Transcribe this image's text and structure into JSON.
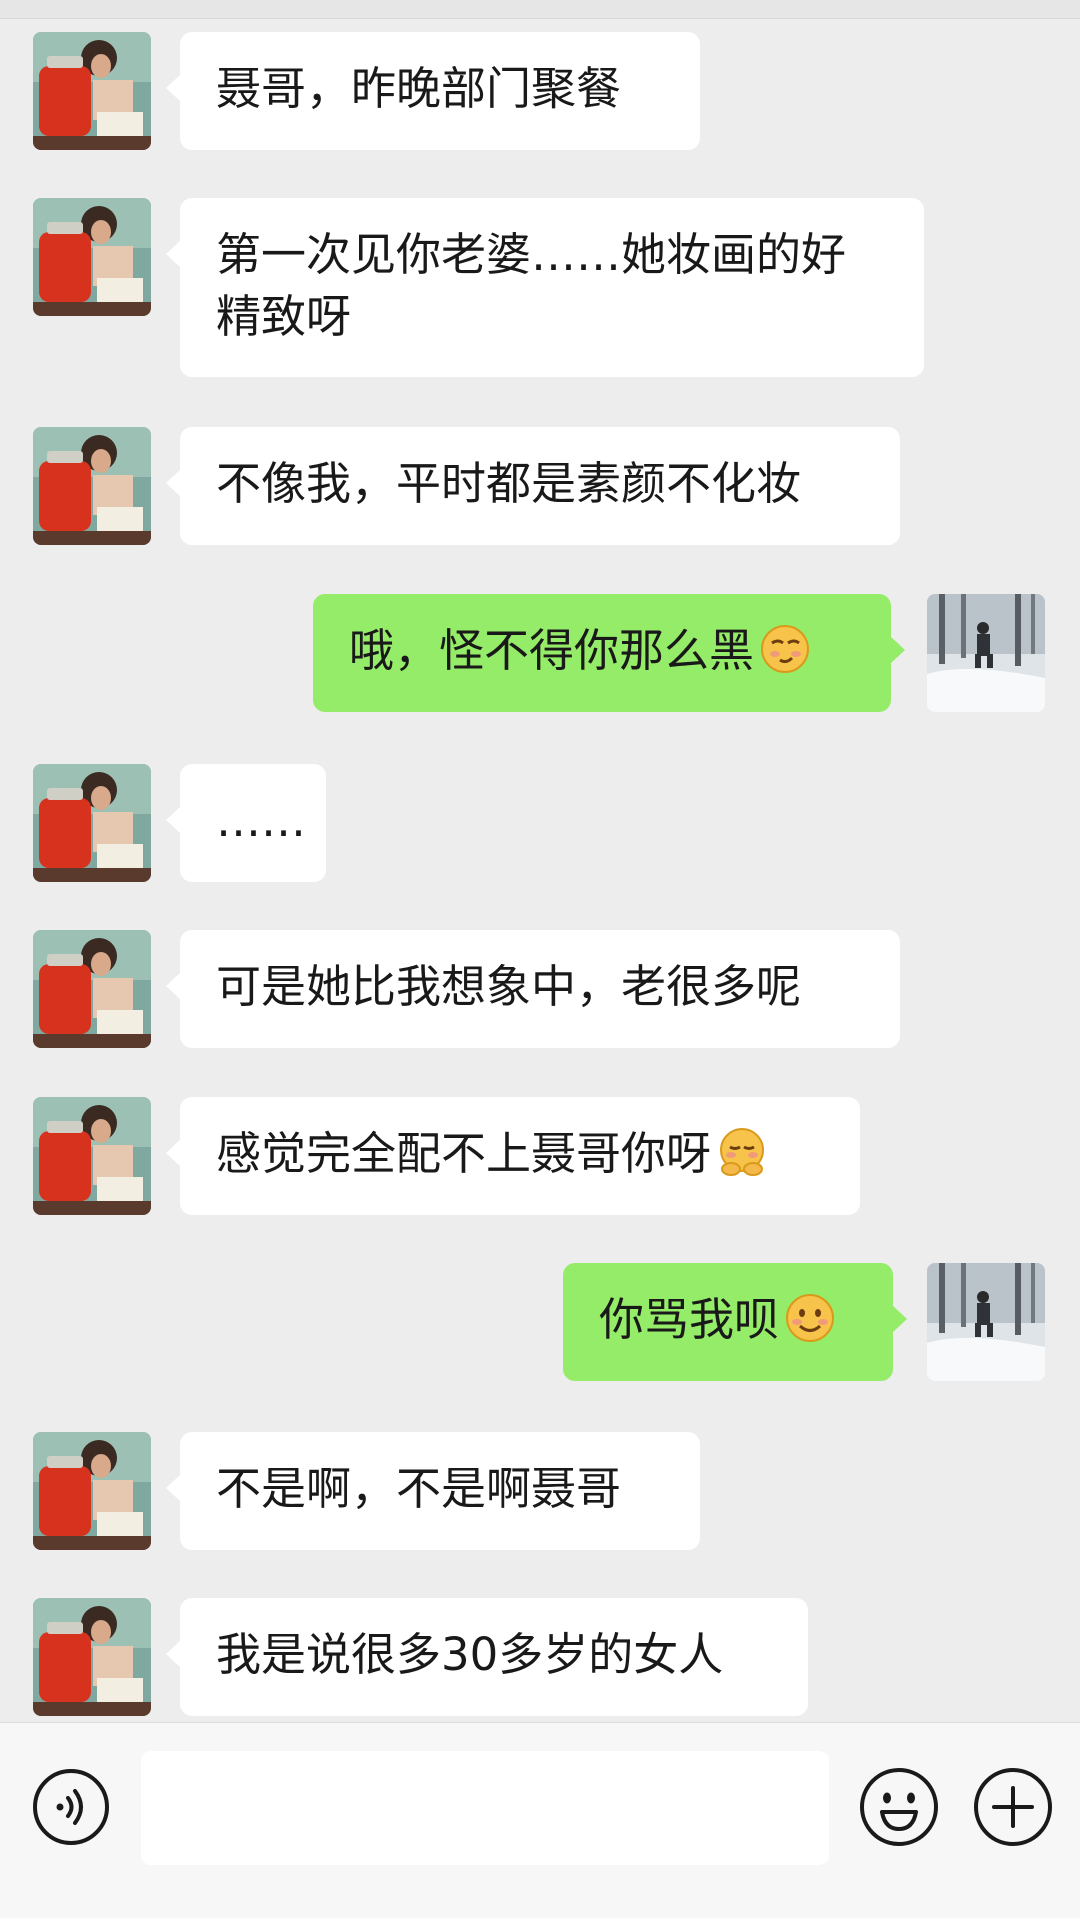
{
  "conversation": {
    "messages": [
      {
        "side": "in",
        "text": "聂哥，昨晚部门聚餐"
      },
      {
        "side": "in",
        "text": "第一次见你老婆……她妆画的好精致呀"
      },
      {
        "side": "in",
        "text": "不像我，平时都是素颜不化妆"
      },
      {
        "side": "out",
        "text": "哦，怪不得你那么黑",
        "emoji": "smirk-face-icon"
      },
      {
        "side": "in",
        "text": "……"
      },
      {
        "side": "in",
        "text": "可是她比我想象中，老很多呢"
      },
      {
        "side": "in",
        "text": "感觉完全配不上聂哥你呀",
        "emoji": "blushing-hands-face-icon"
      },
      {
        "side": "out",
        "text": "你骂我呗",
        "emoji": "smiling-face-icon"
      },
      {
        "side": "in",
        "text": "不是啊，不是啊聂哥"
      },
      {
        "side": "in",
        "text": "我是说很多30多岁的女人"
      }
    ]
  },
  "input_bar": {
    "voice_icon": "voice-icon",
    "text_value": "",
    "emoji_icon": "emoji-icon",
    "plus_icon": "plus-icon"
  },
  "colors": {
    "background": "#ededed",
    "incoming_bubble": "#ffffff",
    "outgoing_bubble": "#95ec69",
    "text": "#191919"
  }
}
